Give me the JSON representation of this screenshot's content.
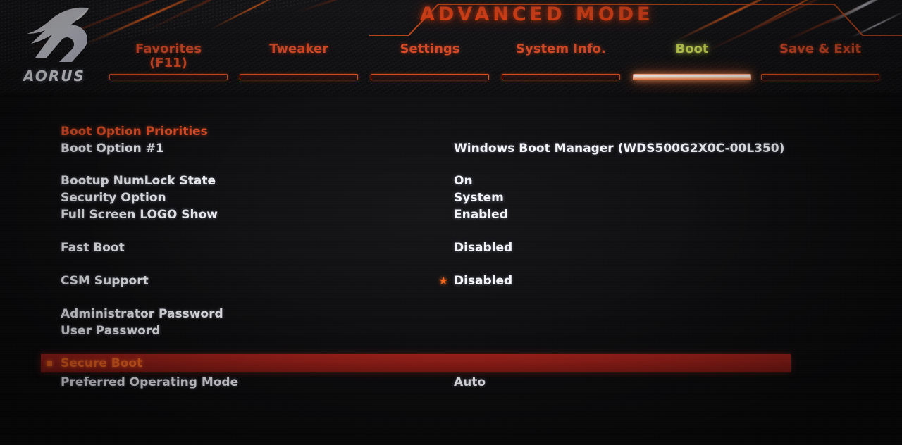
{
  "brand": {
    "logo_icon": "aorus-eagle-icon",
    "wordmark": "AORUS"
  },
  "header": {
    "mode_title": "ADVANCED MODE",
    "accent_color": "#e8512a",
    "active_tab_color": "#d8e85a",
    "highlight_color": "#8e1c16"
  },
  "tabs": [
    {
      "id": "favorites",
      "label": "Favorites\n(F11)",
      "active": false
    },
    {
      "id": "tweaker",
      "label": "Tweaker",
      "active": false
    },
    {
      "id": "settings",
      "label": "Settings",
      "active": false
    },
    {
      "id": "system-info",
      "label": "System Info.",
      "active": false
    },
    {
      "id": "boot",
      "label": "Boot",
      "active": true
    },
    {
      "id": "save-exit",
      "label": "Save & Exit",
      "active": false
    }
  ],
  "rows": [
    {
      "id": "boot-option-priorities",
      "label": "Boot Option Priorities",
      "value": "",
      "section": true,
      "selected": false,
      "marker": ""
    },
    {
      "id": "boot-option-1",
      "label": "Boot Option #1",
      "value": "Windows Boot Manager (WDS500G2X0C-00L350)",
      "section": false,
      "selected": false,
      "marker": ""
    },
    {
      "id": "bootup-numlock-state",
      "label": "Bootup NumLock State",
      "value": "On",
      "section": false,
      "selected": false,
      "marker": ""
    },
    {
      "id": "security-option",
      "label": "Security Option",
      "value": "System",
      "section": false,
      "selected": false,
      "marker": ""
    },
    {
      "id": "full-screen-logo-show",
      "label": "Full Screen LOGO Show",
      "value": "Enabled",
      "section": false,
      "selected": false,
      "marker": ""
    },
    {
      "id": "fast-boot",
      "label": "Fast Boot",
      "value": "Disabled",
      "section": false,
      "selected": false,
      "marker": ""
    },
    {
      "id": "csm-support",
      "label": "CSM Support",
      "value": "Disabled",
      "section": false,
      "selected": false,
      "marker": "star"
    },
    {
      "id": "administrator-password",
      "label": "Administrator Password",
      "value": "",
      "section": false,
      "selected": false,
      "marker": ""
    },
    {
      "id": "user-password",
      "label": "User Password",
      "value": "",
      "section": false,
      "selected": false,
      "marker": ""
    },
    {
      "id": "secure-boot",
      "label": "Secure Boot",
      "value": "",
      "section": false,
      "selected": true,
      "marker": "square"
    },
    {
      "id": "preferred-operating-mode",
      "label": "Preferred Operating Mode",
      "value": "Auto",
      "section": false,
      "selected": false,
      "marker": ""
    }
  ]
}
